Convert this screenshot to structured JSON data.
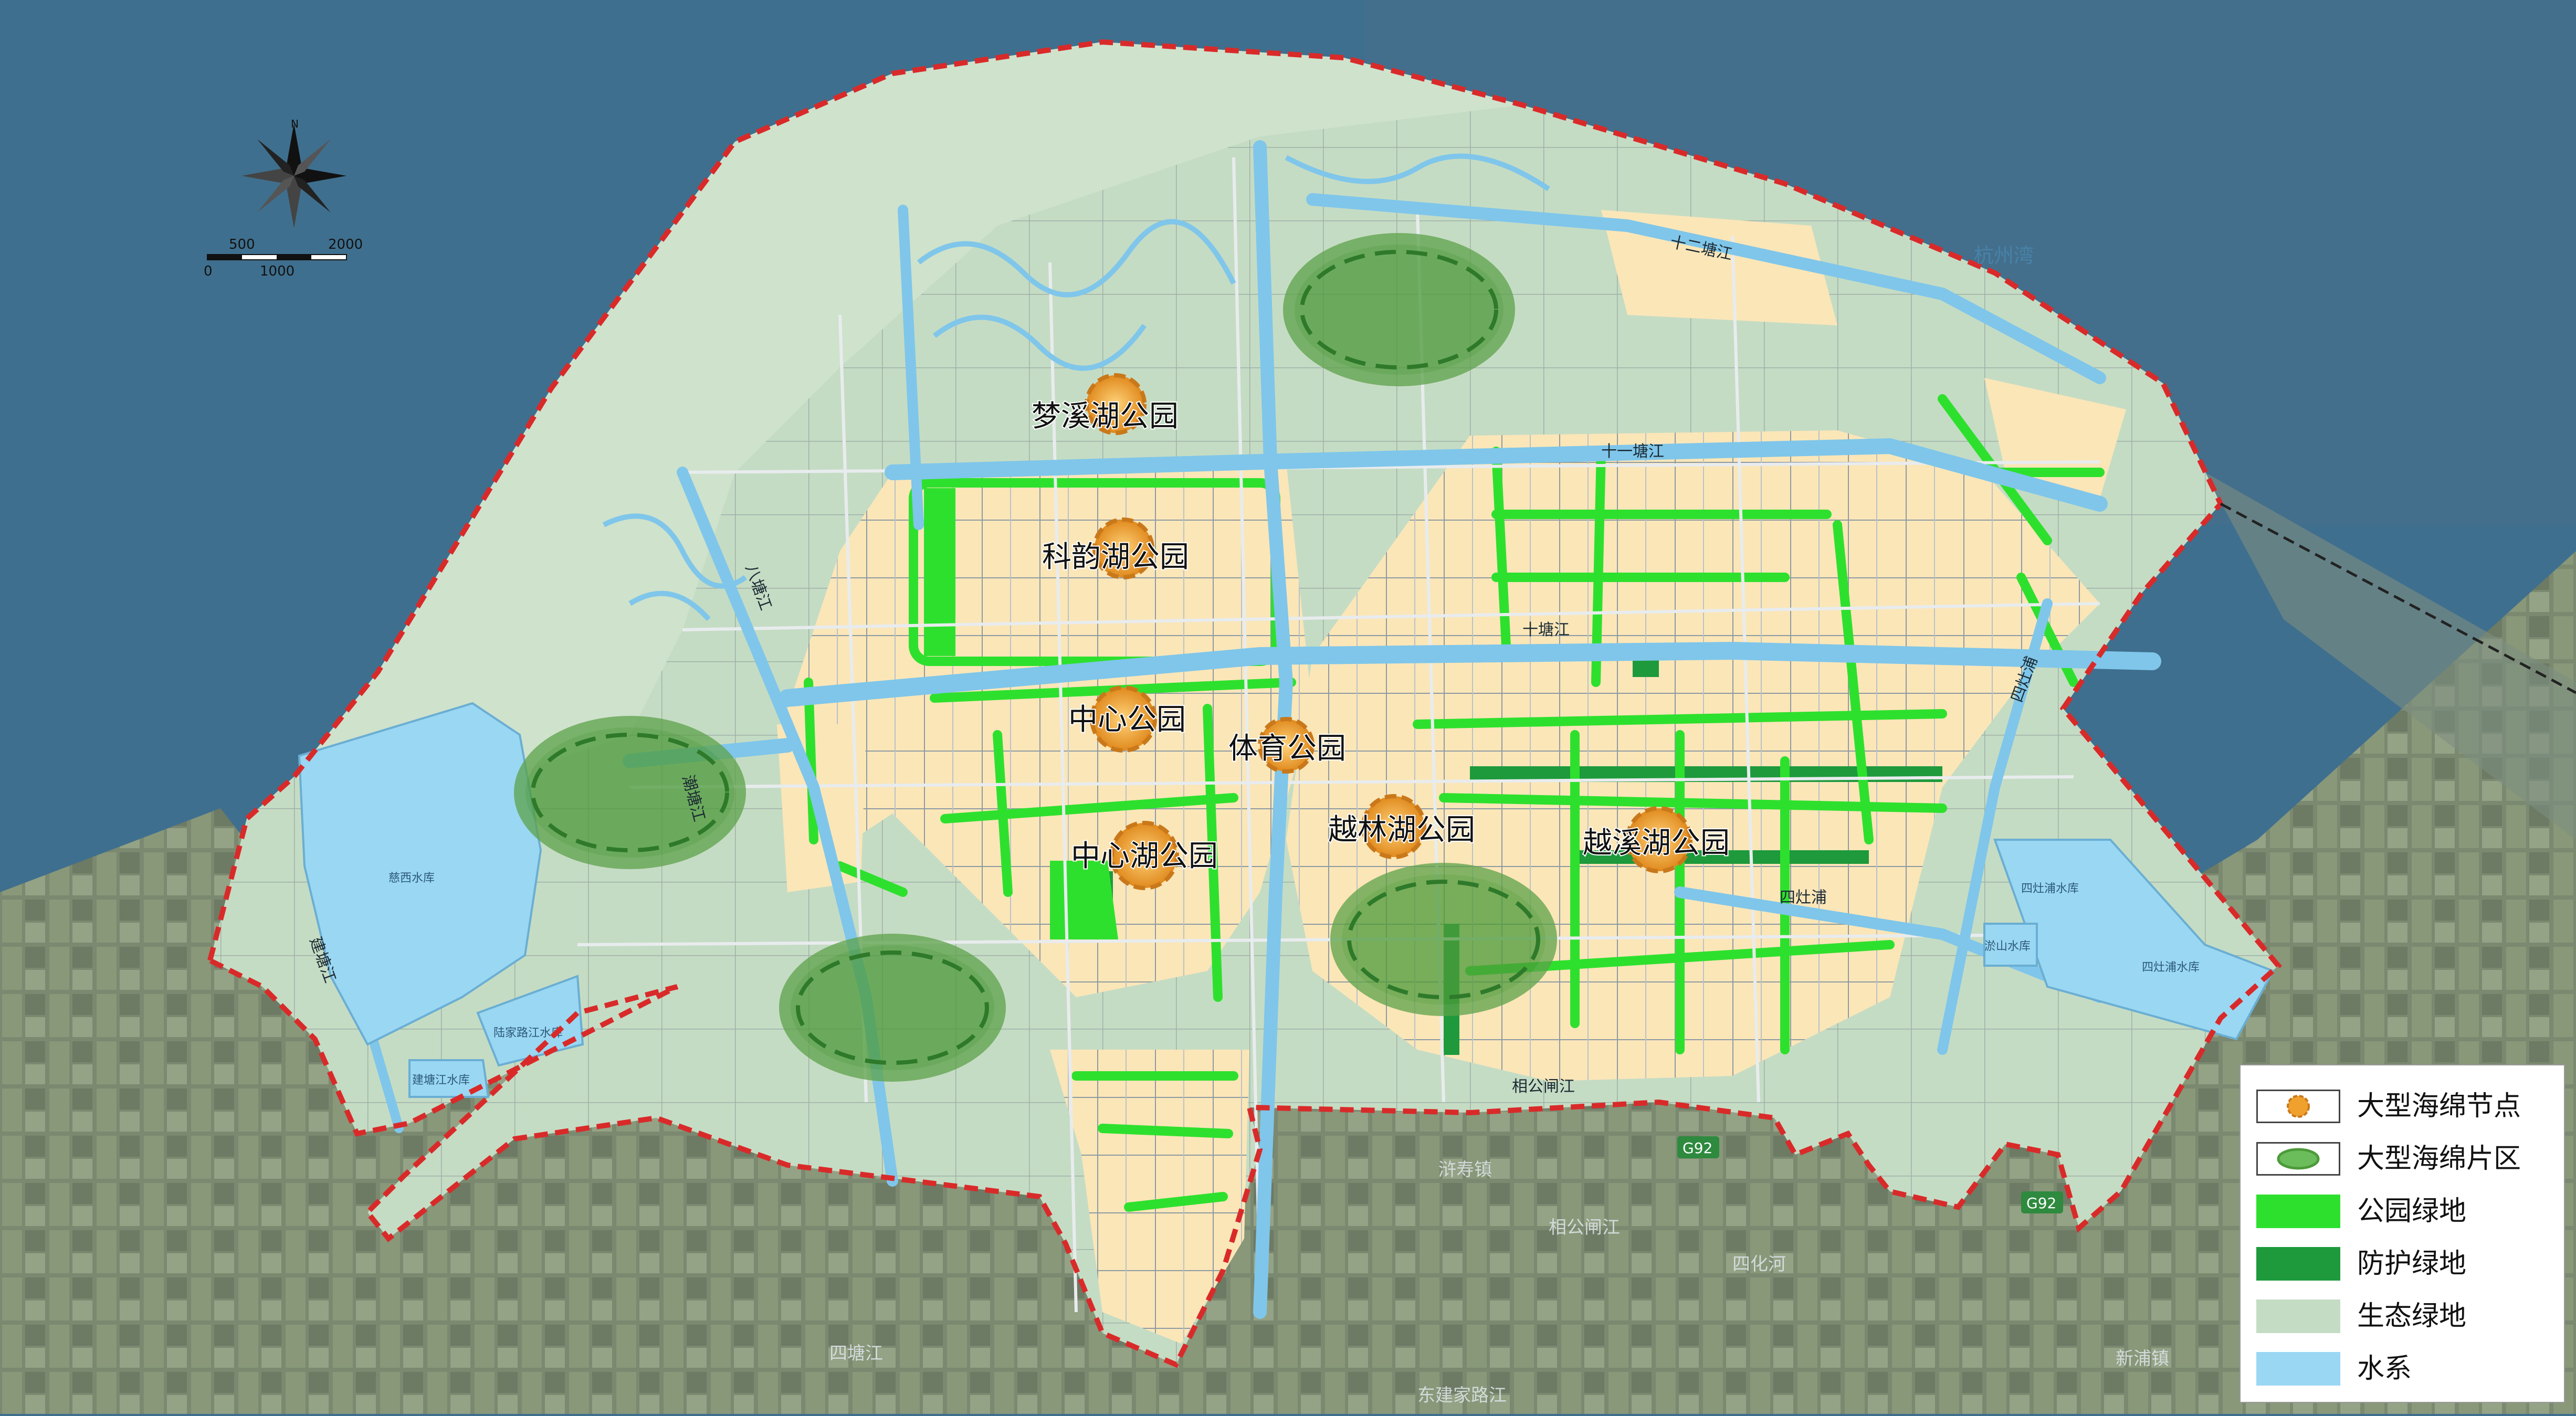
{
  "map": {
    "parks": [
      {
        "name": "梦溪湖公园"
      },
      {
        "name": "科韵湖公园"
      },
      {
        "name": "中心公园"
      },
      {
        "name": "体育公园"
      },
      {
        "name": "中心湖公园"
      },
      {
        "name": "越林湖公园"
      },
      {
        "name": "越溪湖公园"
      }
    ],
    "rivers": [
      "十二塘江",
      "十一塘江",
      "十塘江",
      "八塘江",
      "潮塘江",
      "四灶浦",
      "建塘江",
      "四灶浦",
      "相公闸江"
    ],
    "reservoirs": [
      "慈西水库",
      "陆家路江水库",
      "四灶浦水库",
      "四灶浦水库",
      "淤山水库",
      "建塘江水库"
    ],
    "places": [
      "杭州湾",
      "G92",
      "G92",
      "浒寿镇",
      "相公闸江",
      "四化河",
      "新浦镇",
      "四塘江",
      "东建家路江"
    ],
    "colors": {
      "sea": "#3f6f8e",
      "ecological_green": "#c5dcc4",
      "park_green": "#2ee02e",
      "protective_green": "#1e9a3c",
      "water": "#9ad7f2",
      "urban": "#fbe6b8",
      "boundary": "#d92a2a",
      "node": "#f0a02c"
    }
  },
  "scale_bar": {
    "north": "N",
    "ticks": [
      "0",
      "500",
      "1000",
      "2000"
    ]
  },
  "legend": {
    "items": [
      {
        "label": "大型海绵节点",
        "icon": "sponge-node-icon"
      },
      {
        "label": "大型海绵片区",
        "icon": "sponge-zone-icon"
      },
      {
        "label": "公园绿地",
        "color": "#2ee02e"
      },
      {
        "label": "防护绿地",
        "color": "#1e9a3c"
      },
      {
        "label": "生态绿地",
        "color": "#c5dcc4"
      },
      {
        "label": "水系",
        "color": "#9ad7f2"
      }
    ]
  }
}
